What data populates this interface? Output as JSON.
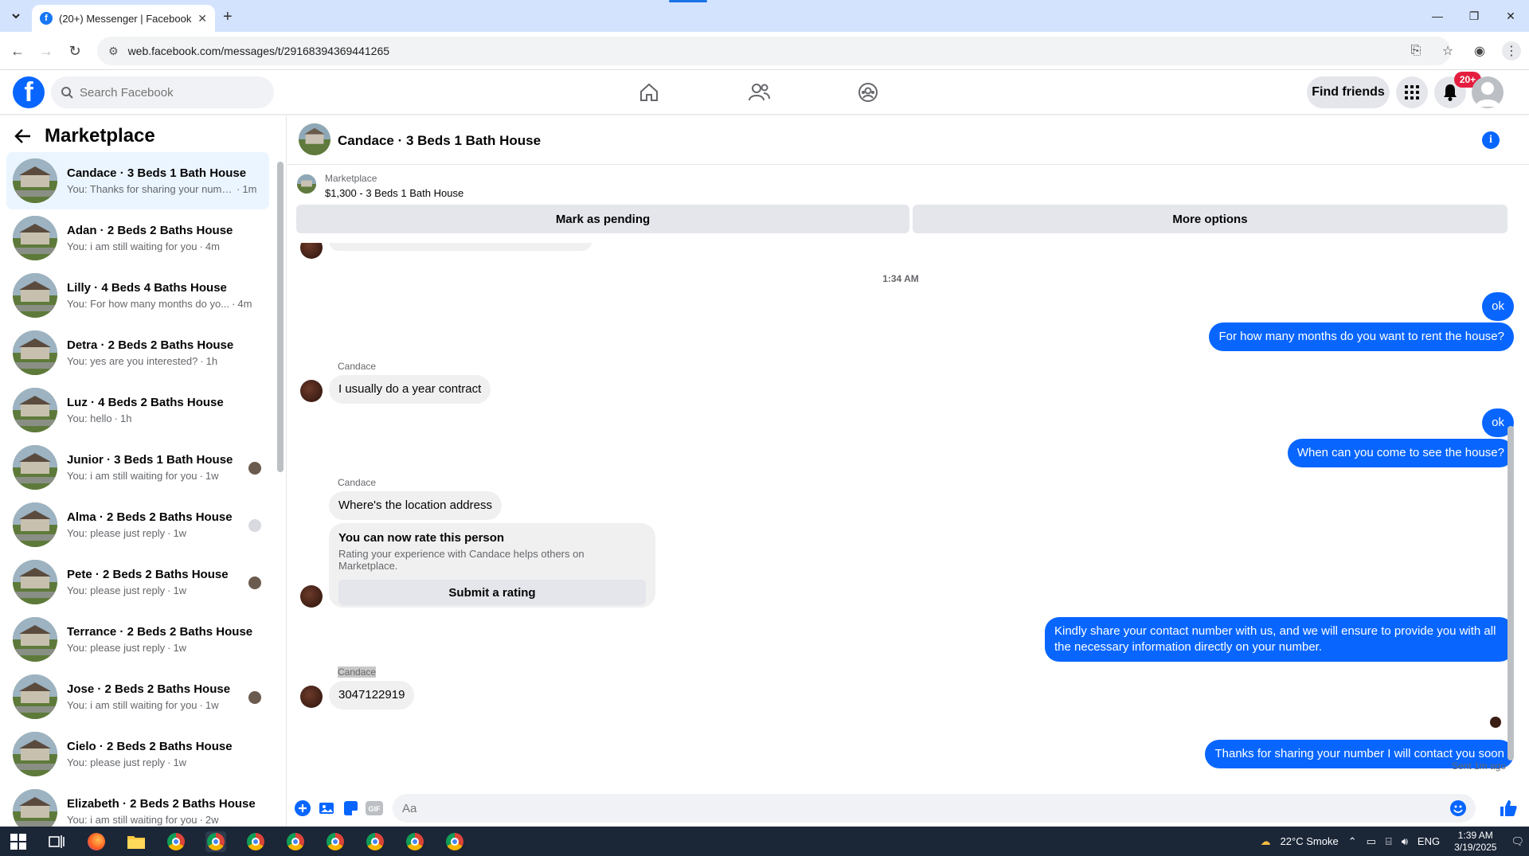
{
  "browser": {
    "tab_title": "(20+) Messenger | Facebook",
    "tab_close": "✕",
    "new_tab": "+",
    "url": "web.facebook.com/messages/t/29168394369441265"
  },
  "fb": {
    "search_placeholder": "Search Facebook",
    "find_friends": "Find friends",
    "notif_badge": "20+"
  },
  "sidebar": {
    "title": "Marketplace",
    "conversations": [
      {
        "name": "Candace · 3 Beds 1 Bath House",
        "snippet": "You: Thanks for sharing your numb...",
        "time": "1m",
        "active": true
      },
      {
        "name": "Adan · 2 Beds 2 Baths House",
        "snippet": "You: i am still waiting for you",
        "time": "4m"
      },
      {
        "name": "Lilly · 4 Beds 4 Baths House",
        "snippet": "You: For how many months do yo...",
        "time": "4m"
      },
      {
        "name": "Detra · 2 Beds 2 Baths House",
        "snippet": "You: yes are you interested?",
        "time": "1h"
      },
      {
        "name": "Luz · 4 Beds 2 Baths House",
        "snippet": "You: hello",
        "time": "1h"
      },
      {
        "name": "Junior · 3 Beds 1 Bath House",
        "snippet": "You: i am still waiting for you",
        "time": "1w"
      },
      {
        "name": "Alma · 2 Beds 2 Baths House",
        "snippet": "You: please just reply",
        "time": "1w"
      },
      {
        "name": "Pete · 2 Beds 2 Baths House",
        "snippet": "You: please just reply",
        "time": "1w"
      },
      {
        "name": "Terrance · 2 Beds 2 Baths House",
        "snippet": "You: please just reply",
        "time": "1w"
      },
      {
        "name": "Jose · 2 Beds 2 Baths House",
        "snippet": "You: i am still waiting for you",
        "time": "1w"
      },
      {
        "name": "Cielo · 2 Beds 2 Baths House",
        "snippet": "You: please just reply",
        "time": "1w"
      },
      {
        "name": "Elizabeth · 2 Beds 2 Baths House",
        "snippet": "You: i am still waiting for you",
        "time": "2w"
      }
    ]
  },
  "chat": {
    "title": "Candace · 3 Beds 1 Bath House",
    "marketplace_label": "Marketplace",
    "listing": "$1,300 - 3 Beds 1 Bath House",
    "mark_pending": "Mark as pending",
    "more_options": "More options",
    "timestamp": "1:34 AM",
    "messages": {
      "out_ok_1": "ok",
      "out_months": "For how many months do you want to rent the house?",
      "in_sender_1": "Candace",
      "in_contract": "I usually do a year contract",
      "out_ok_2": "ok",
      "out_when": "When can you come to see the house?",
      "in_sender_2": "Candace",
      "in_location": "Where's the location address",
      "rate_title": "You can now rate this person",
      "rate_sub": "Rating your experience with Candace helps others on Marketplace.",
      "rate_button": "Submit a rating",
      "out_share": "Kindly share your contact number with us, and we will ensure to provide you with all the necessary information directly on your number.",
      "in_sender_3": "Candace",
      "in_number": "3047122919",
      "out_thanks": "Thanks for sharing your number I will contact you soon",
      "sent_status": "Sent 1m ago"
    },
    "composer_placeholder": "Aa"
  },
  "taskbar": {
    "weather": "22°C  Smoke",
    "lang": "ENG",
    "time": "1:39 AM",
    "date": "3/19/2025"
  }
}
